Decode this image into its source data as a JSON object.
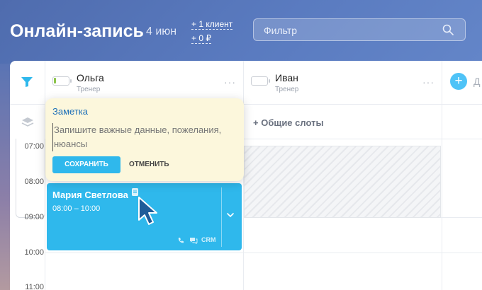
{
  "header": {
    "title": "Онлайн-запись",
    "date": "4 июн",
    "stats": {
      "clients": "+ 1 клиент",
      "revenue": "+ 0 ₽"
    },
    "filter_placeholder": "Фильтр"
  },
  "staff": [
    {
      "name": "Ольга",
      "role": "Тренер"
    },
    {
      "name": "Иван",
      "role": "Тренер"
    }
  ],
  "add_column": {
    "label": "Д"
  },
  "common_slots": "+ Общие слоты",
  "times": [
    "07:00",
    "08:00",
    "09:00",
    "10:00",
    "11:00"
  ],
  "appointment": {
    "client": "Мария Светлова",
    "time": "08:00 – 10:00",
    "crm_label": "CRM"
  },
  "note_popover": {
    "title": "Заметка",
    "placeholder": "Запишите важные данные, пожелания, нюансы",
    "save_label": "СОХРАНИТЬ",
    "cancel_label": "ОТМЕНИТЬ"
  },
  "colors": {
    "accent": "#2fb8ec",
    "header_bg": "#5a7bc0",
    "note_bg": "#fcf7dc"
  }
}
